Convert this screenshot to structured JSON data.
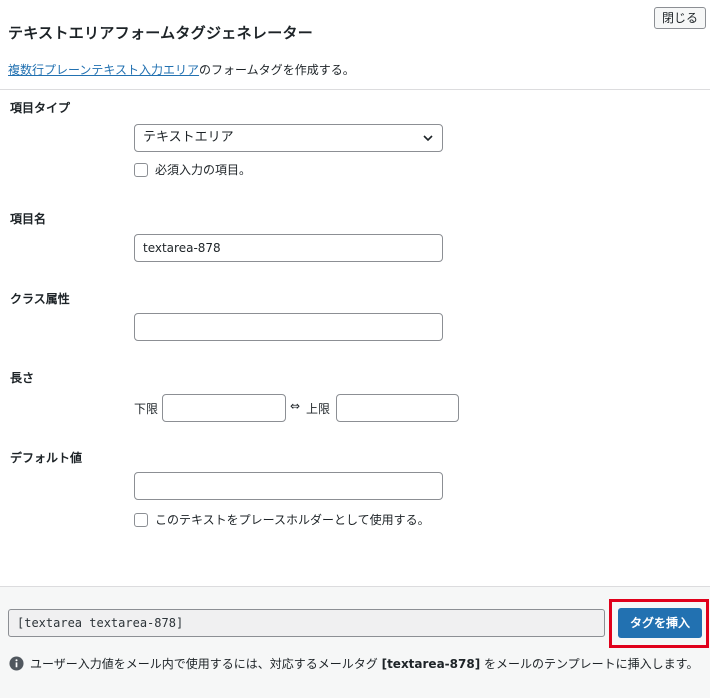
{
  "header": {
    "close_label": "閉じる",
    "title": "テキストエリアフォームタグジェネレーター",
    "desc_link": "複数行プレーンテキスト入力エリア",
    "desc_rest": "のフォームタグを作成する。"
  },
  "form": {
    "field_type": {
      "label": "項目タイプ",
      "selected": "テキストエリア",
      "required_label": "必須入力の項目。"
    },
    "name": {
      "label": "項目名",
      "value": "textarea-878"
    },
    "class_attr": {
      "label": "クラス属性",
      "value": ""
    },
    "length": {
      "label": "長さ",
      "min_label": "下限",
      "arrow": "⇔",
      "max_label": "上限"
    },
    "default_value": {
      "label": "デフォルト値",
      "value": "",
      "placeholder_label": "このテキストをプレースホルダーとして使用する。"
    }
  },
  "footer": {
    "tag_code": "[textarea textarea-878]",
    "insert_label": "タグを挿入",
    "note_pre": "ユーザー入力値をメール内で使用するには、対応するメールタグ ",
    "note_tag": "[textarea-878]",
    "note_post": " をメールのテンプレートに挿入します。"
  },
  "colors": {
    "accent": "#2271b1",
    "highlight": "#e0001b",
    "footer_bg": "#f6f7f7"
  }
}
